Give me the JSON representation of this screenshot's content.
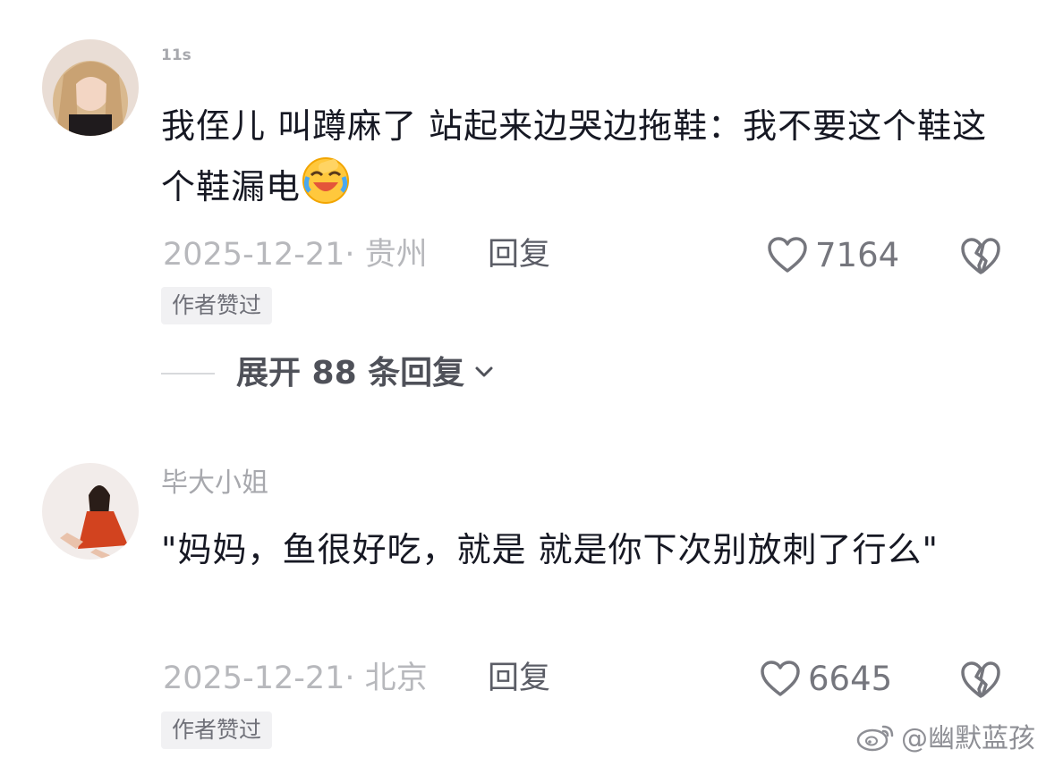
{
  "comments": [
    {
      "username": "11s",
      "text": "我侄儿 叫蹲麻了 站起来边哭边拖鞋：我不要这个鞋这个鞋漏电",
      "emoji_icon": "laughing-crying-emoji-icon",
      "date_location": "2025-12-21· 贵州",
      "reply_label": "回复",
      "likes": "7164",
      "badge": "作者赞过",
      "expand_label": "展开 88 条回复"
    },
    {
      "username": "毕大小姐",
      "text": "\"妈妈，鱼很好吃，就是 就是你下次别放刺了行么\"",
      "date_location": "2025-12-21· 北京",
      "reply_label": "回复",
      "likes": "6645",
      "badge": "作者赞过"
    }
  ],
  "watermark": "@幽默蓝孩",
  "icons": {
    "like": "heart-outline-icon",
    "dislike": "broken-heart-icon",
    "expand": "chevron-down-icon",
    "watermark_logo": "weibo-logo-icon"
  },
  "colors": {
    "text_primary": "#161823",
    "text_secondary": "#b7b8bc",
    "badge_bg": "#f1f1f3"
  }
}
